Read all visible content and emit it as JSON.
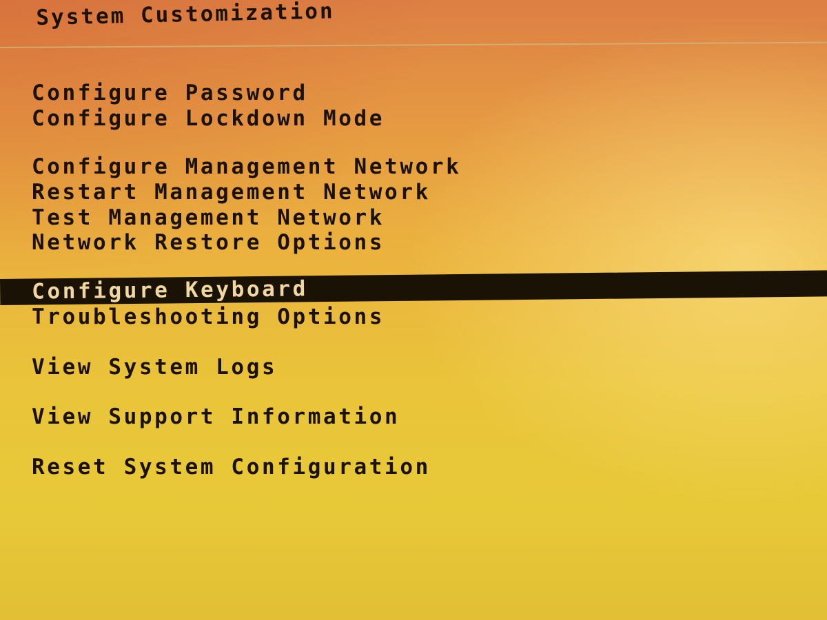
{
  "screen": {
    "title": "System Customization"
  },
  "menu": {
    "selected_index": 6,
    "items": [
      {
        "label": "Configure Password"
      },
      {
        "label": "Configure Lockdown Mode"
      },
      {
        "label": "Configure Management Network"
      },
      {
        "label": "Restart Management Network"
      },
      {
        "label": "Test Management Network"
      },
      {
        "label": "Network Restore Options"
      },
      {
        "label": "Configure Keyboard"
      },
      {
        "label": "Troubleshooting Options"
      },
      {
        "label": "View System Logs"
      },
      {
        "label": "View Support Information"
      },
      {
        "label": "Reset System Configuration"
      }
    ]
  },
  "colors": {
    "text": "#1b1205",
    "highlight_background": "#1a1204",
    "highlight_text": "#f1d7a2",
    "background_top": "#dc7f44",
    "background_bottom": "#e2bf35"
  }
}
